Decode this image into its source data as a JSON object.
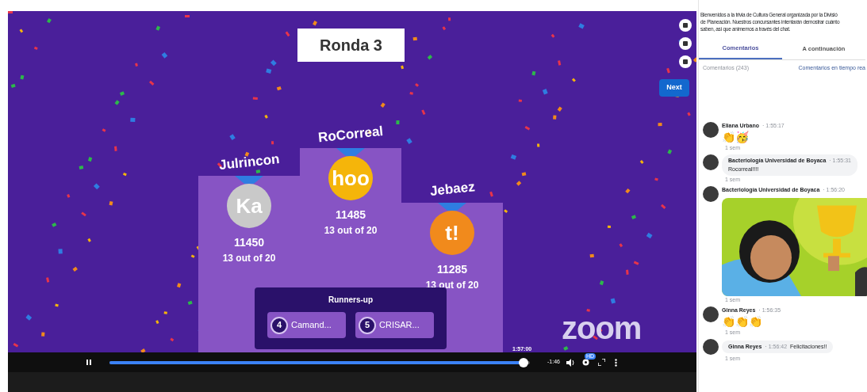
{
  "video": {
    "round_title": "Ronda 3",
    "next_button": "Next",
    "podium": [
      {
        "name": "Julrincon",
        "avatar": "Ka",
        "color": "#c9c9c9",
        "score": "11450",
        "correct": "13 out of 20"
      },
      {
        "name": "RoCorreal",
        "avatar": "hoo",
        "color": "#f5b50a",
        "score": "11485",
        "correct": "13 out of 20"
      },
      {
        "name": "Jebaez",
        "avatar": "t!",
        "color": "#f18a1c",
        "score": "11285",
        "correct": "13 out of 20"
      }
    ],
    "runners_up": {
      "title": "Runners-up",
      "players": [
        {
          "rank": "4",
          "name": "Camand..."
        },
        {
          "rank": "5",
          "name": "CRISAR..."
        }
      ]
    },
    "watermark_logo": "zoom"
  },
  "player": {
    "playing": true,
    "level": 0.985,
    "time_tooltip": "1:57:00",
    "remaining": "-1:46",
    "hd_badge": "HD"
  },
  "sidebar": {
    "description": [
      "Bienvenidos a la trivia de Cultura General organizada por la Divisió",
      "de Planeación. Nuestros concursantes intentarán demostrar cuánto",
      "saben, así que animemos a través del chat."
    ],
    "tabs": [
      {
        "label": "Comentarios",
        "selected": true
      },
      {
        "label": "A continuación",
        "selected": false
      }
    ],
    "comments_count": "Comentarios (243)",
    "sort": "Comentarios en tiempo rea",
    "comments": [
      {
        "kind": "emoji",
        "author": "Eliana Urbano",
        "time": "· 1:55:17",
        "emojis": [
          "👏",
          "🥳"
        ],
        "age": "1 sem"
      },
      {
        "kind": "text",
        "author": "Bacteriología Universidad de Boyaca",
        "time": "· 1:55:31",
        "text": "Rocorreal!!!!",
        "age": "1 sem"
      },
      {
        "kind": "picture",
        "author": "Bacteriología Universidad de Boyaca",
        "time": "· 1:56:20",
        "age": "1 sem"
      },
      {
        "kind": "emoji",
        "author": "Ginna Reyes",
        "time": "· 1:56:35",
        "emojis": [
          "👏",
          "👏",
          "👏"
        ],
        "age": "1 sem"
      },
      {
        "kind": "inline",
        "author": "Ginna Reyes",
        "time": "· 1:56:42",
        "text": "Felicitaciones!!",
        "age": "1 sem"
      }
    ]
  }
}
